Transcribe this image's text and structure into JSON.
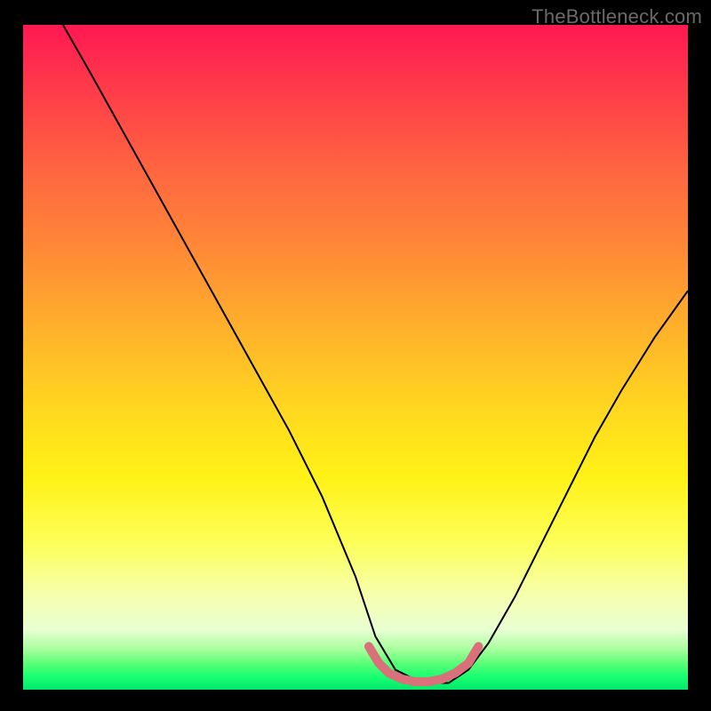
{
  "watermark": "TheBottleneck.com",
  "chart_data": {
    "type": "line",
    "title": "",
    "xlabel": "",
    "ylabel": "",
    "xlim": [
      0,
      100
    ],
    "ylim": [
      0,
      100
    ],
    "grid": false,
    "legend": false,
    "background_gradient": {
      "direction": "vertical",
      "stops": [
        {
          "pos": 0,
          "color": "#ff1852"
        },
        {
          "pos": 22,
          "color": "#ff6640"
        },
        {
          "pos": 46,
          "color": "#ffb22b"
        },
        {
          "pos": 68,
          "color": "#fff216"
        },
        {
          "pos": 86,
          "color": "#f6ffb0"
        },
        {
          "pos": 96,
          "color": "#5cff78"
        },
        {
          "pos": 100,
          "color": "#00e86a"
        }
      ]
    },
    "series": [
      {
        "name": "main-curve",
        "stroke": "#000000",
        "stroke_width": 2,
        "x": [
          6,
          10,
          15,
          20,
          25,
          30,
          35,
          40,
          45,
          50,
          53,
          56,
          60,
          64,
          67,
          70,
          74,
          78,
          82,
          86,
          90,
          95,
          100
        ],
        "y": [
          100,
          93,
          84,
          75,
          66,
          57,
          48,
          39,
          29,
          17,
          8,
          3,
          1,
          1,
          3,
          7,
          14,
          22,
          30,
          38,
          45,
          53,
          60
        ]
      },
      {
        "name": "marker-band",
        "stroke": "#d9707a",
        "stroke_width": 10,
        "linecap": "round",
        "x": [
          52,
          53.5,
          55,
          57,
          59,
          61,
          63,
          65,
          67,
          68.5
        ],
        "y": [
          6.5,
          4,
          2.5,
          1.6,
          1.2,
          1.2,
          1.6,
          2.5,
          4,
          6.5
        ]
      }
    ],
    "annotations": []
  }
}
